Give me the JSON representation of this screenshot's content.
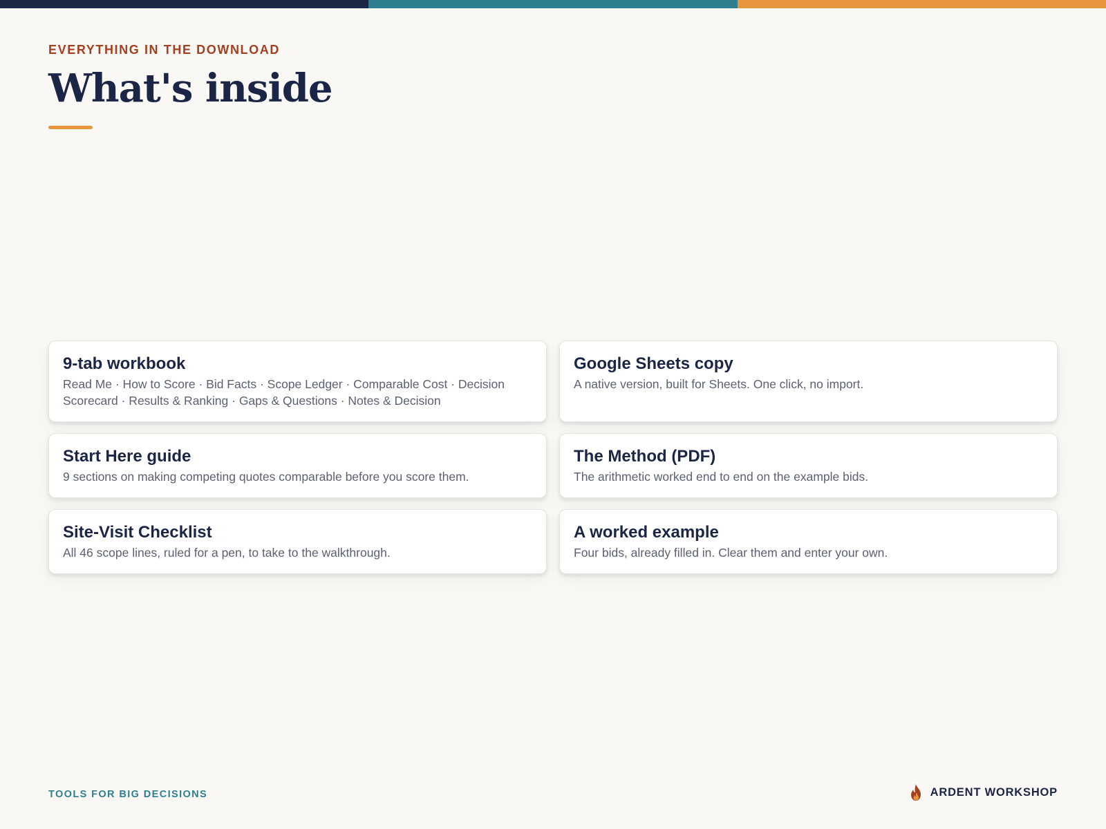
{
  "colors": {
    "navy": "#1b2545",
    "teal": "#2e7f90",
    "orange": "#e8963d",
    "rust": "#a2401f",
    "background": "#faf8f4"
  },
  "header": {
    "eyebrow": "EVERYTHING IN THE DOWNLOAD",
    "title": "What's inside"
  },
  "cards": [
    {
      "title": "9-tab workbook",
      "description": "Read Me · How to Score · Bid Facts · Scope Ledger · Comparable Cost · Decision Scorecard · Results & Ranking · Gaps & Questions · Notes & Decision"
    },
    {
      "title": "Google Sheets copy",
      "description": "A native version, built for Sheets. One click, no import."
    },
    {
      "title": "Start Here guide",
      "description": "9 sections on making competing quotes comparable before you score them."
    },
    {
      "title": "The Method (PDF)",
      "description": "The arithmetic worked end to end on the example bids."
    },
    {
      "title": "Site-Visit Checklist",
      "description": "All 46 scope lines, ruled for a pen, to take to the walkthrough."
    },
    {
      "title": "A worked example",
      "description": "Four bids, already filled in. Clear them and enter your own."
    }
  ],
  "footer": {
    "tagline": "TOOLS FOR BIG DECISIONS",
    "brand_name": "ARDENT WORKSHOP",
    "brand_icon": "flame-icon"
  }
}
